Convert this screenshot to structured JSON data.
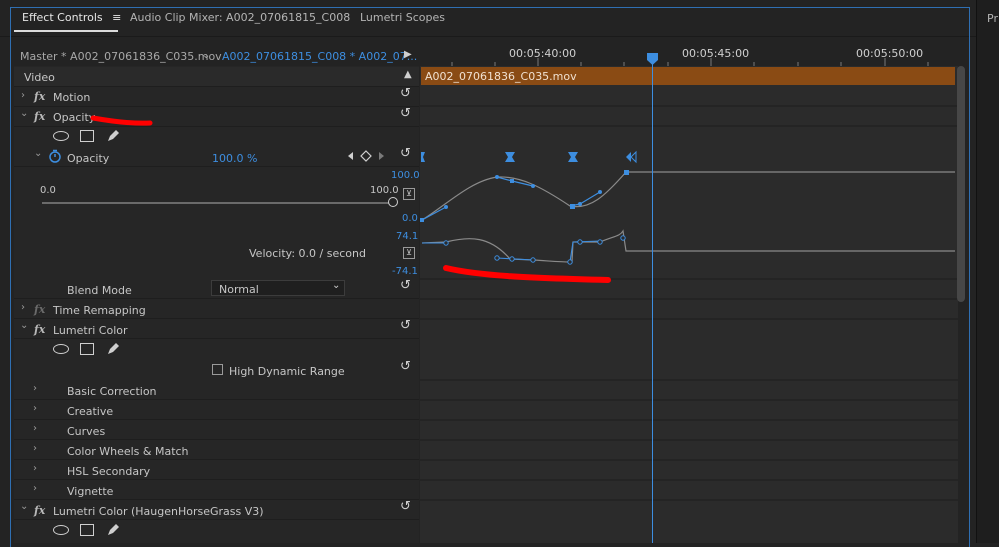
{
  "tabs": [
    {
      "label": "Effect Controls",
      "menu_icon": "≡"
    },
    {
      "label": "Audio Clip Mixer: A002_07061815_C008"
    },
    {
      "label": "Lumetri Scopes"
    }
  ],
  "right_panel_label": "Pr",
  "source_tabs": {
    "master": "Master * A002_07061836_C035.mov",
    "active": "A002_07061815_C008 * A002_07...",
    "play_icon": "▶"
  },
  "ruler": {
    "times": [
      "00:05:40:00",
      "00:05:45:00",
      "00:05:50:00"
    ]
  },
  "clip_bar_label": "A002_07061836_C035.mov",
  "section_video": "Video",
  "effects": {
    "motion": "Motion",
    "opacity": "Opacity",
    "opacity_param": "Opacity",
    "opacity_value": "100.0 %",
    "slider_min": "0.0",
    "slider_max": "100.0",
    "value_graph_top": "100.0",
    "value_graph_bottom": "0.0",
    "velocity_top": "74.1",
    "velocity_bottom": "-74.1",
    "velocity_text": "Velocity: 0.0 / second",
    "blend_mode_label": "Blend Mode",
    "blend_mode_value": "Normal",
    "time_remapping": "Time Remapping",
    "lumetri": "Lumetri Color",
    "hdr_label": "High Dynamic Range",
    "lumetri_sections": [
      "Basic Correction",
      "Creative",
      "Curves",
      "Color Wheels & Match",
      "HSL Secondary",
      "Vignette"
    ],
    "lumetri2": "Lumetri Color (HaugenHorseGrass V3)"
  },
  "glyphs": {
    "fx": "fx",
    "chevron_right": "›",
    "chevron_down": "⌄",
    "reset": "↺",
    "dropdown_arrow": "⌄",
    "expand": "⊻"
  },
  "colors": {
    "accent": "#3d8ee0",
    "clip_bar": "#8a4b14",
    "annotation": "#ff0000",
    "playhead": "#3d8ee0"
  }
}
